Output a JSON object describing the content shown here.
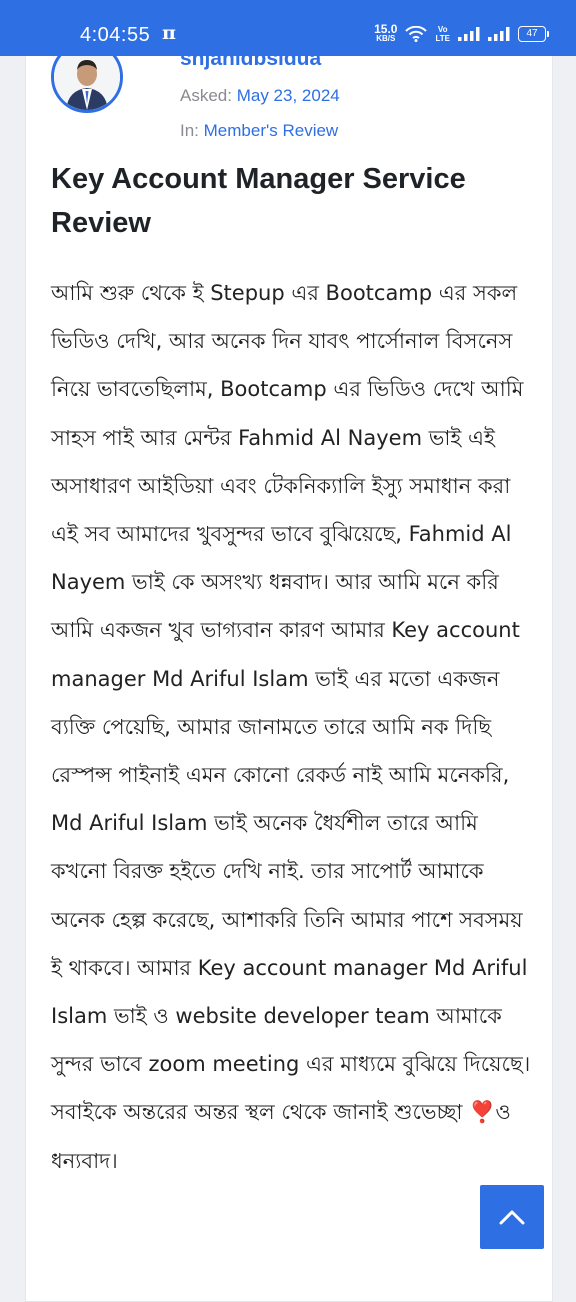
{
  "status_bar": {
    "time": "4:04:55",
    "app_icon": "π",
    "net_speed_value": "15.0",
    "net_speed_unit": "KB/S",
    "volte_top": "Vo",
    "volte_bottom": "LTE",
    "battery": "47"
  },
  "question": {
    "username": "shjahidbsidua",
    "asked_label": "Asked:",
    "asked_date": "May 23, 2024",
    "in_label": "In:",
    "category": "Member's Review",
    "title": "Key Account Manager Service Review",
    "body": "আমি শুরু থেকে ই Stepup এর Bootcamp এর সকল ভিডিও দেখি, আর অনেক দিন যাবৎ পার্সোনাল বিসনেস নিয়ে ভাবতেছিলাম, Bootcamp এর ভিডিও দেখে আমি সাহস পাই আর মেন্টর Fahmid Al Nayem ভাই এই অসাধারণ আইডিয়া এবং টেকনিক্যালি ইস্যু সমাধান করা এই সব আমাদের খুবসুন্দর ভাবে বুঝিয়েছে, Fahmid Al Nayem ভাই কে অসংখ্য ধন্নবাদ। আর আমি মনে করি আমি একজন খুব ভাগ্যবান কারণ আমার Key account manager Md Ariful Islam ভাই এর মতো একজন ব্যক্তি পেয়েছি, আমার জানামতে তারে আমি নক দিছি রেস্পন্স পাইনাই এমন কোনো রেকর্ড নাই আমি মনেকরি, Md Ariful Islam ভাই অনেক ধৈর্যশীল তারে আমি কখনো বিরক্ত হইতে দেখি নাই. তার সাপোর্ট আমাকে অনেক হেল্প করেছে, আশাকরি তিনি আমার পাশে সবসময় ই থাকবে। আমার Key account manager Md Ariful Islam ভাই ও website developer team আমাকে সুন্দর ভাবে zoom meeting এর মাধ্যমে বুঝিয়ে দিয়েছে। সবাইকে অন্তরের অন্তর স্থল থেকে জানাই শুভেচ্ছা ❣️ও ধন্যবাদ।"
  },
  "icons": {
    "wifi": "wifi-icon",
    "signal": "signal-icon",
    "battery": "battery-icon",
    "scroll_top": "chevron-up-icon"
  },
  "colors": {
    "accent": "#2f6fe4",
    "title": "#1f2328",
    "meta_gray": "#888b90"
  }
}
